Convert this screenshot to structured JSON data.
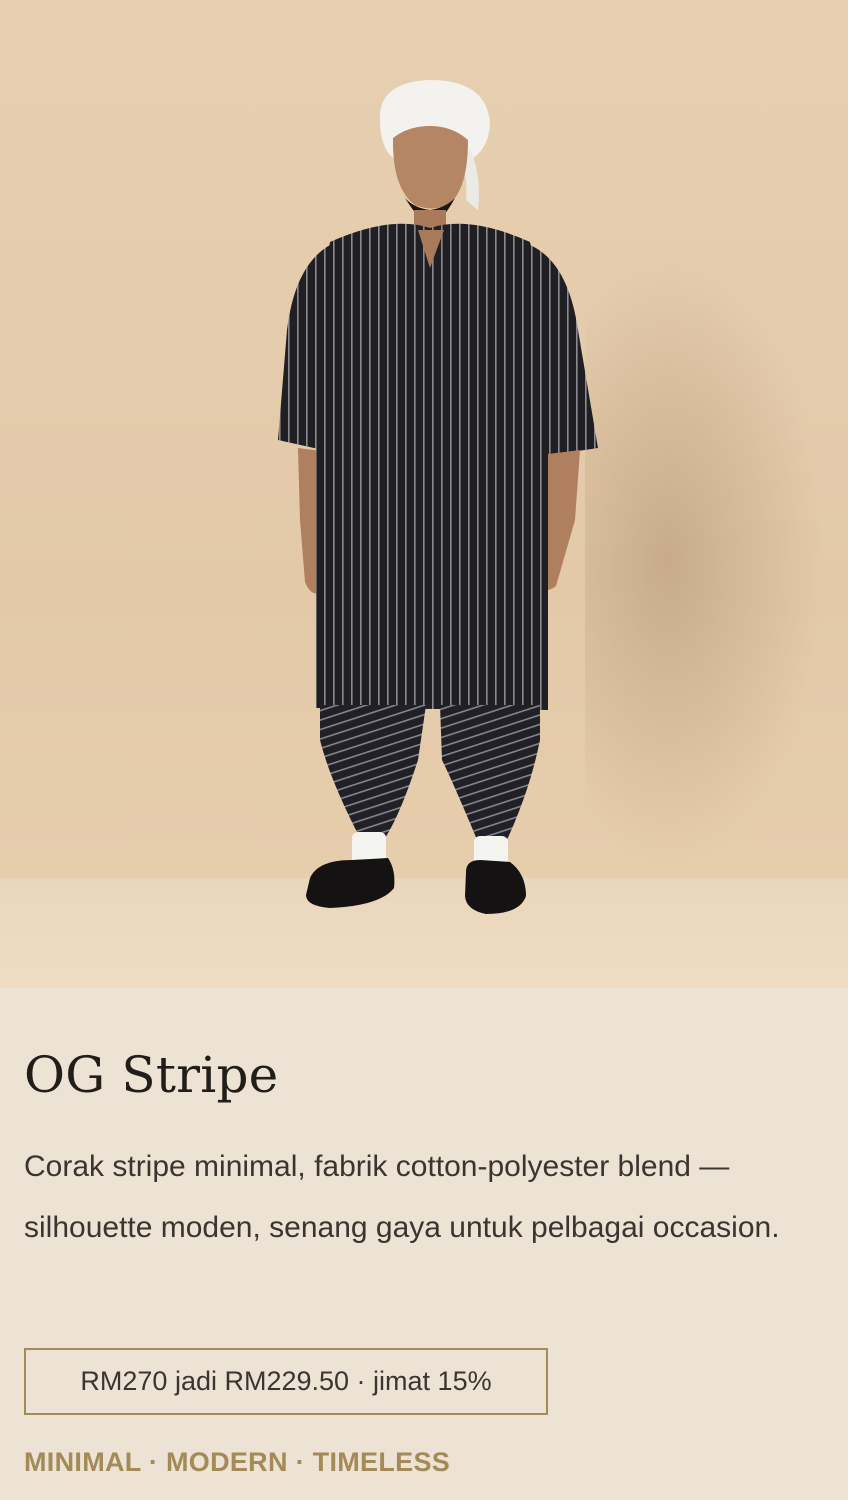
{
  "product": {
    "image_alt": "model wearing striped baju and pants with white turban",
    "name": "OG Stripe",
    "description": "Corak stripe minimal, fabrik cotton-polyester blend — silhouette moden, senang gaya untuk pelbagai occasion.",
    "price_text": "RM270 jadi RM229.50 · jimat 15%",
    "tagline": "MINIMAL · MODERN · TIMELESS"
  },
  "colors": {
    "background": "#ede3d4",
    "hero_background": "#e3c9a8",
    "accent": "#a48a56",
    "title": "#211d19",
    "body_text": "#3a3531"
  }
}
